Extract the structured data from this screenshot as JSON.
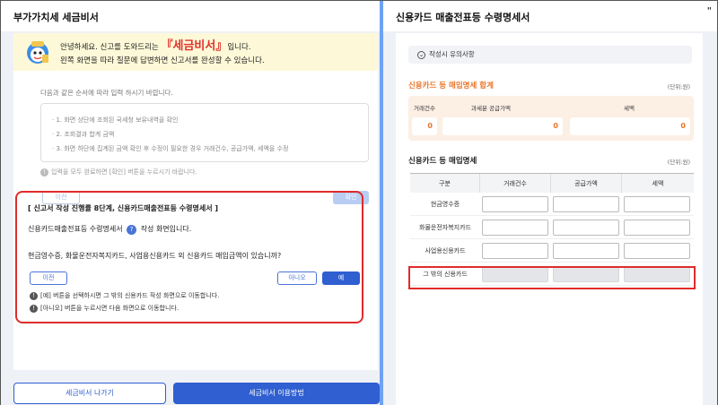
{
  "left": {
    "title": "부가가치세 세금비서",
    "greeting": {
      "prefix": "안녕하세요. 신고를 도와드리는 ",
      "brand_open": "『",
      "brand": "세금비서",
      "brand_close": "』",
      "suffix": "입니다.",
      "line2": "왼쪽 화면을 따라 질문에 답변하면 신고서를 완성할 수 있습니다."
    },
    "instruction": "다음과 같은 순서에 따라 입력 하시기 바랍니다.",
    "steps": [
      "· 1. 화면 상단에 조회된 국세청 보유내역을 확인",
      "· 2. 조회결과 합계 금액",
      "· 3. 화면 하단에 집계된 금액 확인 후 수정이 필요한 경우 거래건수, 공급가액, 세액을 수정"
    ],
    "complete_hint": "입력을 모두 완료하면 [확인] 버튼을 누르시기 바랍니다.",
    "prev_faded": "이전",
    "ok_faded": "확인",
    "step_box": {
      "title": "[ 신고서 작성 진행률 8단계, 신용카드매출전표등 수령명세서 ]",
      "desc_prefix": "신용카드매출전표등 수령명세서",
      "desc_suffix": "작성 화면입니다.",
      "question": "현금영수증, 화물운전자복지카드, 사업용신용카드 외 신용카드 매입금액이 있습니까?",
      "prev_label": "이전",
      "no_label": "아니오",
      "yes_label": "예",
      "note1": "[예] 버튼을 선택하시면 그 밖의 신용카드 작성 화면으로 이동합니다.",
      "note2": "[아니오] 버튼을 누르시면 다음 화면으로 이동합니다."
    },
    "exit_label": "세금비서 나가기",
    "help_label": "세금비서 이용방법"
  },
  "right": {
    "title": "신용카드 매출전표등 수령명세서",
    "corner": "\"",
    "caution": "작성시 유의사항",
    "sum_title": "신용카드 등 매입명세 합계",
    "unit": "(단위:원)",
    "sum_labels": [
      "거래건수",
      "과세분 공급가액",
      "세액"
    ],
    "sum_values": [
      "0",
      "0",
      "0"
    ],
    "detail_title": "신용카드 등 매입명세",
    "columns": [
      "구분",
      "거래건수",
      "공급가액",
      "세액"
    ],
    "rows": [
      "현금영수증",
      "화물운전자복지카드",
      "사업용신용카드",
      "그 밖의 신용카드"
    ]
  },
  "colors": {
    "accent": "#2f5fd0",
    "highlight": "#e02b2b",
    "orange": "#e8752b"
  }
}
